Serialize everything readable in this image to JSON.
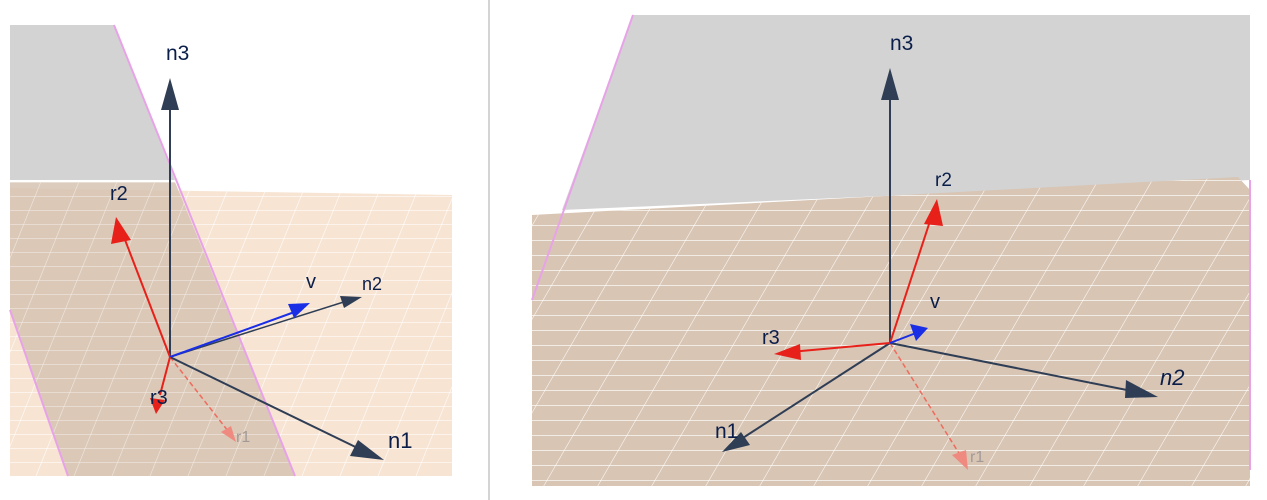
{
  "left_view": {
    "labels": {
      "n3": "n3",
      "r2": "r2",
      "v": "v",
      "n2": "n2",
      "r3": "r3",
      "r1": "r1",
      "n1": "n1"
    }
  },
  "right_view": {
    "labels": {
      "n3": "n3",
      "r2": "r2",
      "v": "v",
      "r3": "r3",
      "n2": "n2",
      "n1": "n1",
      "r1": "r1"
    }
  },
  "colors": {
    "axis_n": "#2f3e55",
    "axis_r": "#e8201a",
    "axis_r_faded": "#ef6b5e",
    "vector_v": "#1a2ee6",
    "plane_gray": "#d3d3d3",
    "plane_edge": "#e8a3e8",
    "floor": "#f7e4d3",
    "floor_shaded": "#d9c4b2",
    "grid": "#ffffff"
  }
}
